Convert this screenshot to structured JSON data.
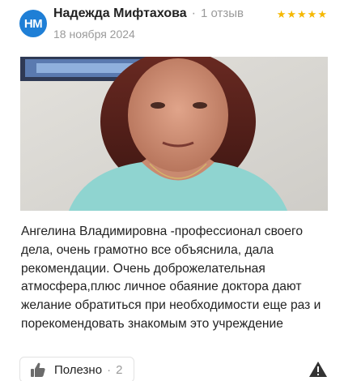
{
  "review": {
    "avatar_initials": "НМ",
    "author": "Надежда Мифтахова",
    "separator": "·",
    "reviews_count": "1 отзыв",
    "date": "18 ноября 2024",
    "rating": 5,
    "stars": "★★★★★",
    "text": "Ангелина Владимировна -профессионал своего дела, очень грамотно все объяснила, дала рекомендации. Очень доброжелательная атмосфера,плюс личное обаяние доктора дают желание обратиться при необходимости еще раз и порекомендовать знакомым это учреждение",
    "helpful_label": "Полезно",
    "helpful_separator": "·",
    "helpful_count": "2"
  },
  "colors": {
    "avatar": "#1f7fd6",
    "stars": "#f5b800",
    "muted": "#9a9a9a"
  },
  "icons": {
    "helpful": "thumbs-up-icon",
    "report": "warning-triangle-icon"
  }
}
